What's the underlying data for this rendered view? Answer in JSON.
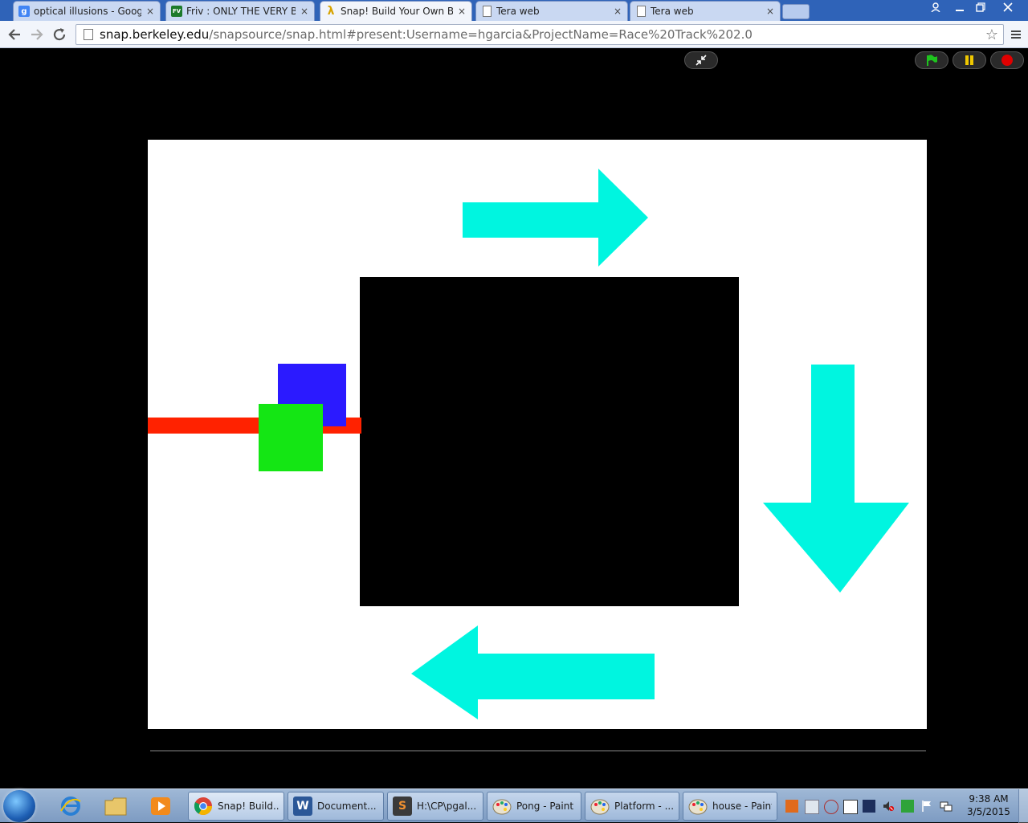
{
  "browser": {
    "tabs": [
      {
        "label": "optical illusions - Google S",
        "favicon": "google-icon",
        "color": "#4285f4"
      },
      {
        "label": "Friv : ONLY THE VERY BES",
        "favicon": "friv-icon",
        "color": "#1c7a2a"
      },
      {
        "label": "Snap! Build Your Own Blo",
        "favicon": "snap-lambda-icon",
        "color": "#d7a300",
        "active": true
      },
      {
        "label": "Tera web",
        "favicon": "page-icon"
      },
      {
        "label": "Tera web",
        "favicon": "page-icon"
      }
    ],
    "close_glyph": "×",
    "url_host": "snap.berkeley.edu",
    "url_path": "/snapsource/snap.html#present:Username=hgarcia&ProjectName=Race%20Track%202.0"
  },
  "snap": {
    "controls": [
      "exit-presentation-icon",
      "green-flag-icon",
      "pause-icon",
      "stop-icon"
    ],
    "colors": {
      "track_background": "#ffffff",
      "center_block": "#000000",
      "arrows": "#00f5e0",
      "finish_line": "#ff2200",
      "blue_car": "#2b1aff",
      "green_car": "#14e614",
      "flag": "#1ec41e",
      "pause": "#f0c800",
      "stop": "#e00000"
    }
  },
  "taskbar": {
    "pinned": [
      "internet-explorer-icon",
      "file-explorer-icon",
      "media-player-icon"
    ],
    "buttons": [
      {
        "label": "Snap! Build...",
        "icon": "chrome-icon",
        "active": true
      },
      {
        "label": "Document...",
        "icon": "word-icon",
        "glyph": "W"
      },
      {
        "label": "H:\\CP\\pgal...",
        "icon": "sublime-icon",
        "glyph": "S"
      },
      {
        "label": "Pong - Paint",
        "icon": "paint-icon"
      },
      {
        "label": "Platform - ...",
        "icon": "paint-icon"
      },
      {
        "label": "house - Paint",
        "icon": "paint-icon"
      }
    ],
    "time": "9:38 AM",
    "date": "3/5/2015"
  }
}
